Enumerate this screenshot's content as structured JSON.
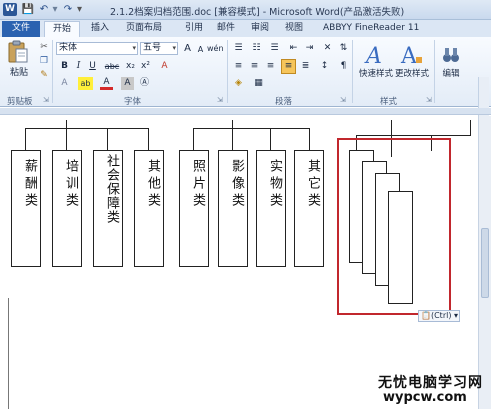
{
  "app": {
    "logo_letter": "W",
    "window_title": "2.1.2档案归档范围.doc [兼容模式] - Microsoft Word(产品激活失败)"
  },
  "quick_access": {
    "save": "💾",
    "undo": "↶",
    "sep": "▾",
    "redo": "↷",
    "customize": "▾"
  },
  "tabs": [
    {
      "label": "文件"
    },
    {
      "label": "开始"
    },
    {
      "label": "插入"
    },
    {
      "label": "页面布局"
    },
    {
      "label": "引用"
    },
    {
      "label": "邮件"
    },
    {
      "label": "审阅"
    },
    {
      "label": "视图"
    },
    {
      "label": "ABBYY FineReader 11"
    }
  ],
  "ribbon": {
    "clipboard": {
      "paste_label": "粘贴",
      "group_label": "剪贴板"
    },
    "font": {
      "font_name": "宋体",
      "font_size": "五号",
      "group_label": "字体",
      "bold": "B",
      "italic": "I",
      "underline": "U",
      "strike": "abc",
      "subscript": "x₂",
      "superscript": "x²",
      "grow": "A",
      "shrink": "A",
      "font_color": "A",
      "highlight": "ab",
      "char_border": "A",
      "char_shade": "A",
      "phonetic": "wén",
      "clear": "A"
    },
    "paragraph": {
      "group_label": "段落"
    },
    "styles": {
      "quick_styles": "快速样式",
      "change_styles": "更改样式",
      "group_label": "样式"
    },
    "editing": {
      "edit_label": "编辑"
    }
  },
  "document": {
    "boxes": [
      {
        "text": "薪酬类"
      },
      {
        "text": "培训类"
      },
      {
        "text": "社会保障类"
      },
      {
        "text": "其他类"
      },
      {
        "text": "照片类"
      },
      {
        "text": "影像类"
      },
      {
        "text": "实物类"
      },
      {
        "text": "其它类"
      }
    ],
    "paste_options": "(Ctrl)"
  },
  "watermark": {
    "cn": "无忧电脑学习网",
    "en": "wypcw.com"
  },
  "colors": {
    "accent": "#2b62b0",
    "selection": "#c1272d"
  }
}
